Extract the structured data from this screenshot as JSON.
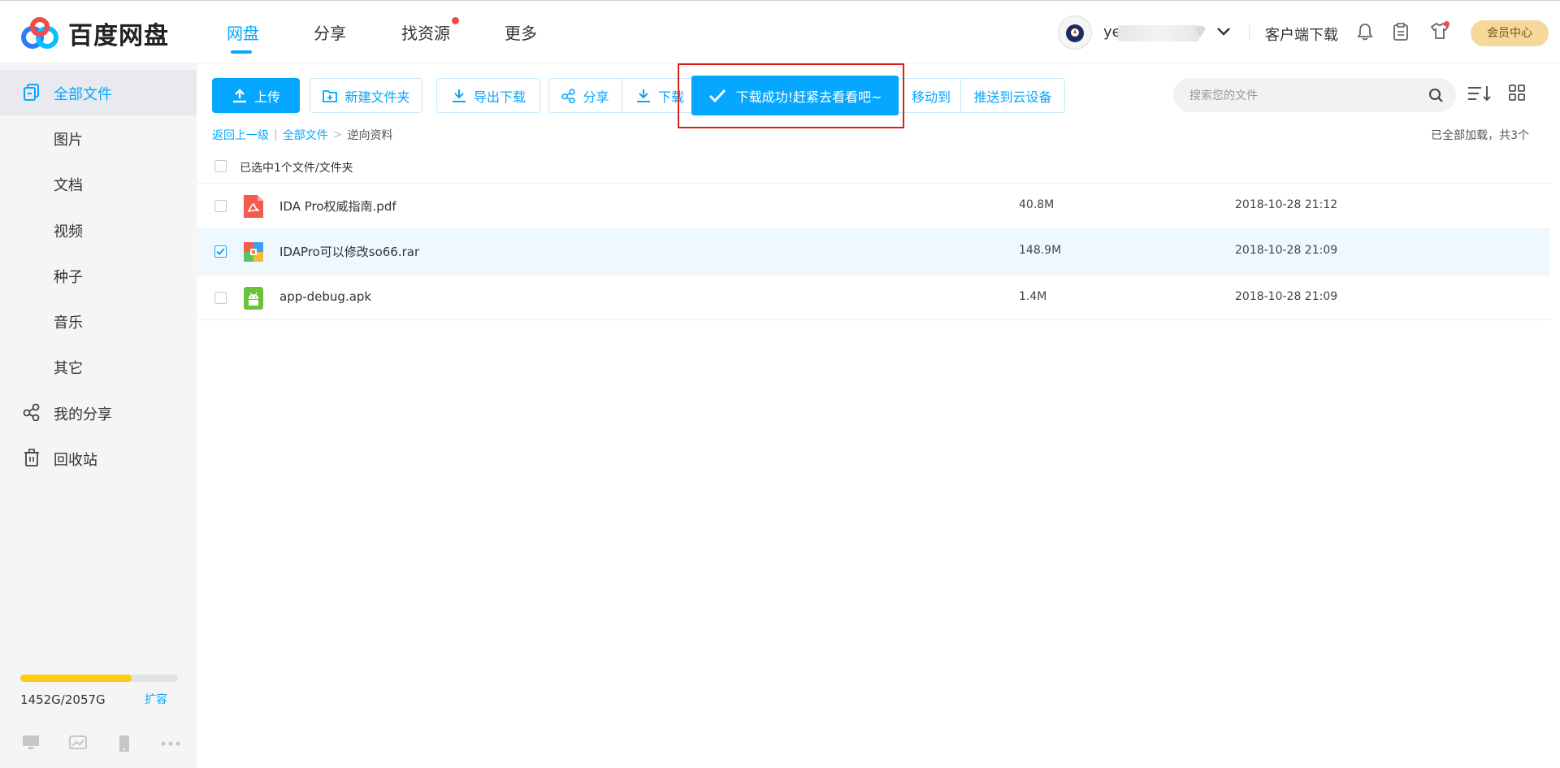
{
  "brand": {
    "name": "百度网盘"
  },
  "nav": [
    {
      "label": "网盘",
      "active": true
    },
    {
      "label": "分享",
      "active": false
    },
    {
      "label": "找资源",
      "active": false,
      "badge": true
    },
    {
      "label": "更多",
      "active": false
    }
  ],
  "user": {
    "name_visible": "yea"
  },
  "header": {
    "client_download": "客户端下载",
    "vip": "会员中心"
  },
  "sidebar": {
    "items": [
      {
        "label": "全部文件",
        "active": true
      },
      {
        "label": "图片"
      },
      {
        "label": "文档"
      },
      {
        "label": "视频"
      },
      {
        "label": "种子"
      },
      {
        "label": "音乐"
      },
      {
        "label": "其它"
      },
      {
        "label": "我的分享"
      },
      {
        "label": "回收站"
      }
    ],
    "storage": {
      "text": "1452G/2057G",
      "used_fraction": 0.706,
      "expand": "扩容"
    }
  },
  "toolbar": {
    "upload": "上传",
    "new_folder": "新建文件夹",
    "export_download": "导出下载",
    "share": "分享",
    "download": "下载",
    "move_to": "移动到",
    "push_cloud": "推送到云设备"
  },
  "toast": {
    "message": "下载成功!赶紧去看看吧~"
  },
  "search": {
    "placeholder": "搜索您的文件"
  },
  "breadcrumb": {
    "back": "返回上一级",
    "root": "全部文件",
    "sep": ">",
    "current": "逆向资料"
  },
  "list_status": "已全部加载，共3个",
  "selection_info": "已选中1个文件/文件夹",
  "files": [
    {
      "name": "IDA Pro权威指南.pdf",
      "size": "40.8M",
      "date": "2018-10-28 21:12",
      "type": "pdf",
      "checked": false
    },
    {
      "name": "IDAPro可以修改so66.rar",
      "size": "148.9M",
      "date": "2018-10-28 21:09",
      "type": "rar",
      "checked": true
    },
    {
      "name": "app-debug.apk",
      "size": "1.4M",
      "date": "2018-10-28 21:09",
      "type": "apk",
      "checked": false
    }
  ],
  "colors": {
    "accent": "#06a7ff",
    "highlight": "#e01d1d",
    "storage": "#fccb14"
  }
}
